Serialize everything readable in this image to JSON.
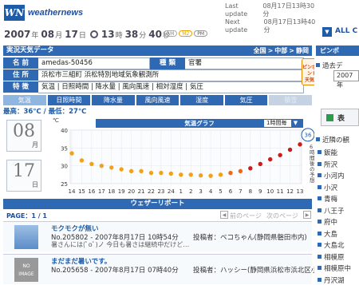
{
  "logo": {
    "mark": "WN",
    "text": "weathernews"
  },
  "update": {
    "last_label": "Last update",
    "last_value": "08月17日13時30分",
    "next_label": "Next update",
    "next_value": "08月17日13時40分"
  },
  "now": {
    "year": "2007",
    "year_u": "年",
    "month": "08",
    "month_u": "月",
    "day": "17",
    "day_u": "日",
    "hour": "13",
    "hour_u": "時",
    "min": "38",
    "min_u": "分",
    "sec": "40",
    "sec_u": "秒"
  },
  "badges": [
    "AM",
    "M2",
    "PM"
  ],
  "nav_right": {
    "label": "ALL C"
  },
  "header": {
    "title": "実況天気データ",
    "crumbs": [
      "全国",
      ">",
      "中部",
      ">",
      "静岡"
    ]
  },
  "side_header": "ピンポ",
  "info": {
    "name_label": "名 前",
    "name_value": "amedas-50456",
    "kind_label": "種 類",
    "kind_value": "官署",
    "addr_label": "住 所",
    "addr_value": "浜松市三組町 浜松特別地域気象観測所",
    "feat_label": "特 徴",
    "feat_value": "気温 | 日照時間 | 降水量 | 風向風速 | 相対湿度 | 気圧"
  },
  "pinpoint": {
    "line1": "ピンポイント",
    "line2": "天気へ"
  },
  "tabs": [
    "気温",
    "日照時間",
    "降水量",
    "風向風速",
    "湿度",
    "気圧",
    "積雪"
  ],
  "temps": {
    "text": "最高：36℃ / 最低：27℃"
  },
  "calendar": {
    "month": "08",
    "month_u": "月",
    "day": "17",
    "day_u": "日"
  },
  "graph": {
    "title": "気温グラフ",
    "range": "1時間毎",
    "range_arrow": "▼",
    "ylabel": "℃",
    "forecast_note": "6時間後の予想",
    "current_value": "36"
  },
  "chart_data": {
    "type": "line",
    "ylabel": "℃",
    "ylim": [
      25,
      40
    ],
    "categories": [
      "14",
      "15",
      "16",
      "17",
      "18",
      "19",
      "20",
      "21",
      "22",
      "23",
      "24",
      "1",
      "2",
      "3",
      "4",
      "5",
      "6",
      "7",
      "8",
      "9",
      "10",
      "11",
      "12",
      "13"
    ],
    "values": [
      33.5,
      31.5,
      30.5,
      30.0,
      29.5,
      29.0,
      28.5,
      28.5,
      28.0,
      28.0,
      27.8,
      27.5,
      27.5,
      27.3,
      27.2,
      27.5,
      28.0,
      28.5,
      29.3,
      30.5,
      31.8,
      33.0,
      34.5,
      36.0
    ],
    "y_ticks": [
      40,
      35,
      30,
      25
    ]
  },
  "report": {
    "header": "ウェザーリポート",
    "page_label": "PAGE：1 / 1",
    "prev_label": "前のページ",
    "next_label": "次のページ",
    "items": [
      {
        "title": "モクモクが無い",
        "meta": "No.205802 - 2007年8月17日 10時54分",
        "poster": "投稿者：ベコちゃん(静岡県磐田市内)",
        "body": "暑さんには(ﾟoﾟ)ノ\n今日も暑さは継続中だけど…"
      },
      {
        "title": "まだまだ暑いです。",
        "meta": "No.205658 - 2007年8月17日 07時40分",
        "poster": "投稿者：ハッシー(静岡県浜松市浜北区小松)",
        "body": "NO IMAGE"
      }
    ]
  },
  "side": {
    "past_label": "過去デ",
    "year": "2007年",
    "button": "表",
    "nearby_label": "近隣の観",
    "nearby": [
      "鈑能",
      "所沢",
      "小河内",
      "小沢",
      "青梅",
      "八王子",
      "府中",
      "大島",
      "大島北",
      "相模原",
      "相模原中",
      "丹沢湖"
    ]
  }
}
